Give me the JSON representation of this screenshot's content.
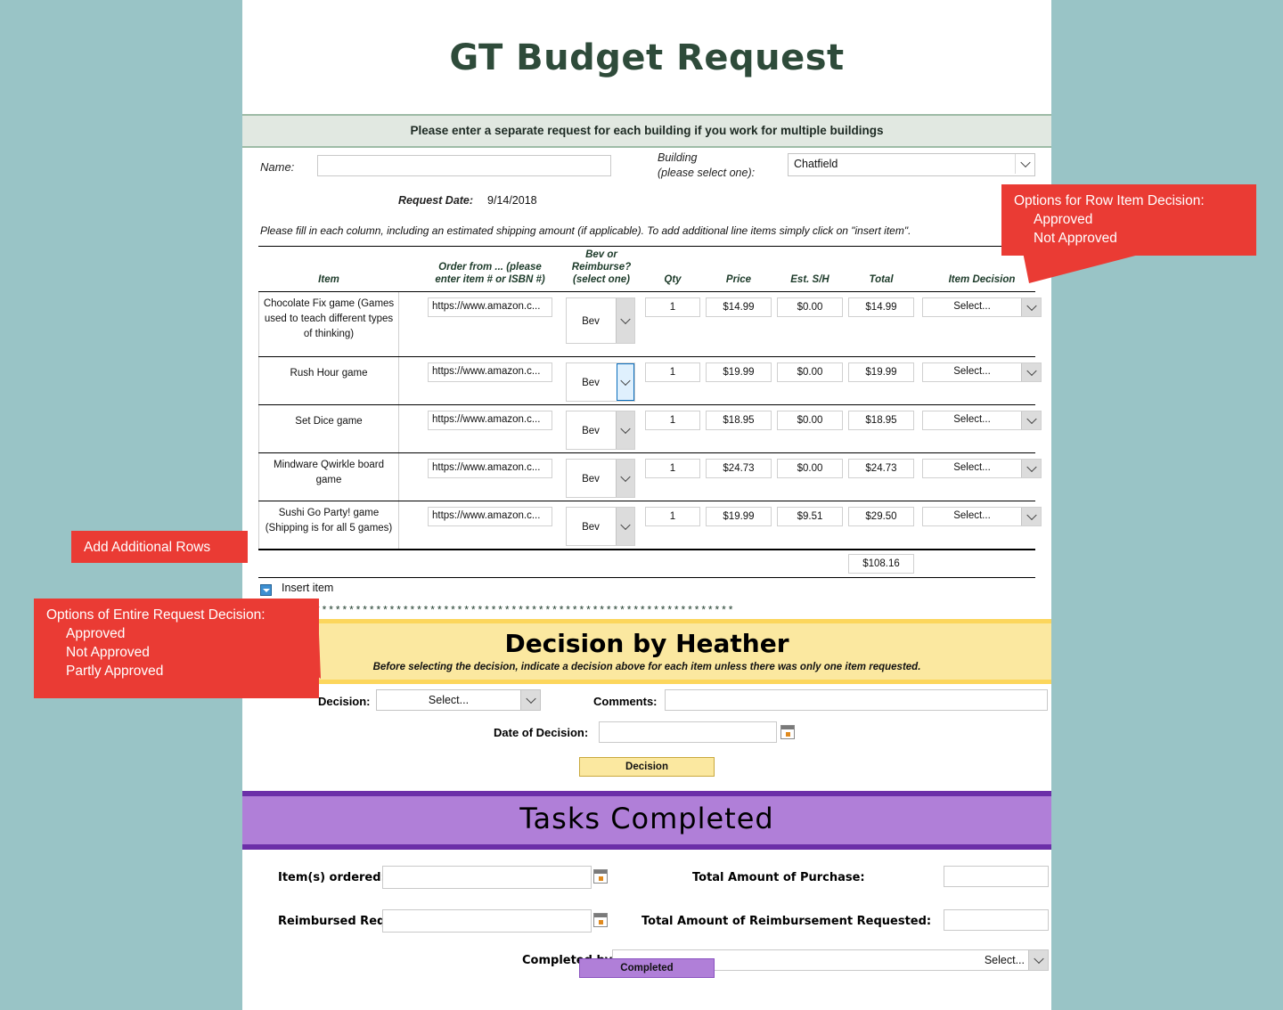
{
  "page": {
    "title": "GT Budget Request",
    "banner_note": "Please enter a separate request for each building if you work for multiple buildings"
  },
  "form": {
    "name_label": "Name:",
    "name_value": "",
    "building_label_line1": "Building",
    "building_label_line2": "(please select one):",
    "building_value": "Chatfield",
    "request_date_label": "Request Date:",
    "request_date_value": "9/14/2018",
    "instructions": "Please fill in each column, including an estimated shipping amount (if applicable). To add additional line items simply click on \"insert item\"."
  },
  "table": {
    "headers": {
      "item": "Item",
      "order_from": "Order from ... (please enter item # or ISBN #)",
      "order_from_l1": "Order from ... (please",
      "order_from_l2": "enter item # or ISBN #)",
      "bev_l1": "Bev or",
      "bev_l2": "Reimburse?",
      "bev_l3": "(select one)",
      "qty": "Qty",
      "price": "Price",
      "sh": "Est. S/H",
      "total": "Total",
      "item_decision": "Item Decision"
    },
    "rows": [
      {
        "item": "Chocolate Fix game (Games used to teach different types of thinking)",
        "order_from": "https://www.amazon.c...",
        "bev": "Bev",
        "qty": "1",
        "price": "$14.99",
        "sh": "$0.00",
        "total": "$14.99",
        "decision": "Select..."
      },
      {
        "item": "Rush Hour game",
        "order_from": "https://www.amazon.c...",
        "bev": "Bev",
        "qty": "1",
        "price": "$19.99",
        "sh": "$0.00",
        "total": "$19.99",
        "decision": "Select..."
      },
      {
        "item": "Set Dice game",
        "order_from": "https://www.amazon.c...",
        "bev": "Bev",
        "qty": "1",
        "price": "$18.95",
        "sh": "$0.00",
        "total": "$18.95",
        "decision": "Select..."
      },
      {
        "item": "Mindware Qwirkle board game",
        "order_from": "https://www.amazon.c...",
        "bev": "Bev",
        "qty": "1",
        "price": "$24.73",
        "sh": "$0.00",
        "total": "$24.73",
        "decision": "Select..."
      },
      {
        "item": "Sushi Go Party! game (Shipping is for all 5 games)",
        "order_from": "https://www.amazon.c...",
        "bev": "Bev",
        "qty": "1",
        "price": "$19.99",
        "sh": "$9.51",
        "total": "$29.50",
        "decision": "Select..."
      }
    ],
    "grand_total": "$108.16",
    "insert_item_label": "Insert item",
    "separator": "**********************************************************************"
  },
  "decision_section": {
    "heading": "Decision by Heather",
    "subheading": "Before selecting the decision, indicate a decision above for each item unless there was only one item requested.",
    "decision_label": "Decision:",
    "decision_value": "Select...",
    "comments_label": "Comments:",
    "comments_value": "",
    "date_label": "Date of Decision:",
    "date_value": "",
    "button_label": "Decision"
  },
  "tasks_section": {
    "heading": "Tasks Completed",
    "items_ordered_label": "Item(s) ordered:",
    "items_ordered_value": "",
    "total_purchase_label": "Total Amount of Purchase:",
    "total_purchase_value": "",
    "reimbursed_label": "Reimbursed Req.:",
    "reimbursed_value": "",
    "total_reimbursement_label": "Total Amount of Reimbursement Requested:",
    "total_reimbursement_value": "",
    "completed_by_label": "Completed by:",
    "completed_by_value": "Select...",
    "button_label": "Completed"
  },
  "callouts": {
    "item_decision": {
      "title": "Options for Row Item Decision:",
      "option1": "Approved",
      "option2": "Not Approved"
    },
    "add_rows": {
      "title": "Add Additional Rows"
    },
    "request_decision": {
      "title": "Options of Entire Request Decision:",
      "option1": "Approved",
      "option2": "Not Approved",
      "option3": "Partly Approved"
    }
  },
  "colors": {
    "background": "#99c4c6",
    "title": "#2e4b3a",
    "green_banner": "#e1e8e1",
    "yellow_banner": "#fbe8a0",
    "purple_banner": "#b07fd8",
    "callout_red": "#ea3b34"
  }
}
